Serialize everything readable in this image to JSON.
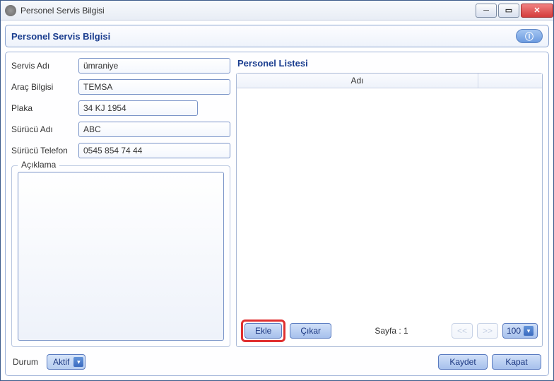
{
  "window": {
    "title": "Personel Servis Bilgisi"
  },
  "header": {
    "title": "Personel Servis Bilgisi",
    "info_icon": "ⓘ"
  },
  "form": {
    "servis_adi": {
      "label": "Servis Adı",
      "value": "ümraniye"
    },
    "arac_bilgisi": {
      "label": "Araç Bilgisi",
      "value": "TEMSA"
    },
    "plaka": {
      "label": "Plaka",
      "value": "34 KJ 1954"
    },
    "surucu_adi": {
      "label": "Sürücü Adı",
      "value": "ABC"
    },
    "surucu_telefon": {
      "label": "Sürücü Telefon",
      "value": "0545 854 74 44"
    },
    "aciklama_label": "Açıklama",
    "aciklama_value": ""
  },
  "list": {
    "title": "Personel Listesi",
    "col_adi": "Adı",
    "ekle": "Ekle",
    "cikar": "Çıkar",
    "page_label": "Sayfa : 1",
    "prev": "<<",
    "next": ">>",
    "page_size": "100"
  },
  "footer": {
    "durum_label": "Durum",
    "durum_value": "Aktif",
    "kaydet": "Kaydet",
    "kapat": "Kapat"
  }
}
